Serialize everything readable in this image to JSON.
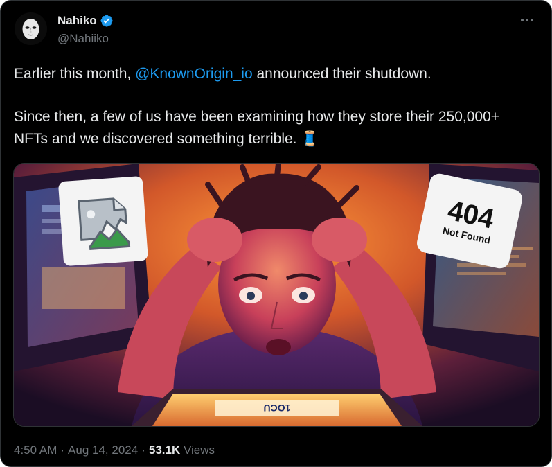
{
  "author": {
    "display_name": "Nahiko",
    "handle": "@Nahiiko",
    "verified": true
  },
  "tweet": {
    "line1_pre": "Earlier this month, ",
    "line1_mention": "@KnownOrigin_io",
    "line1_post": " announced their shutdown.",
    "line2": "Since then, a few of us have been examining how they store their 250,000+ NFTs and we discovered something terrible. 🧵"
  },
  "media": {
    "badge_404_number": "404",
    "badge_404_text": "Not Found",
    "broken_image_icon": "broken-image-icon",
    "laptop_text": "1OCU"
  },
  "meta": {
    "time": "4:50 AM",
    "sep1": "·",
    "date": "Aug 14, 2024",
    "sep2": "·",
    "views_count": "53.1K",
    "views_label": "Views"
  },
  "colors": {
    "accent": "#1d9bf0",
    "text": "#e7e9ea",
    "muted": "#71767b",
    "background": "#000000"
  }
}
